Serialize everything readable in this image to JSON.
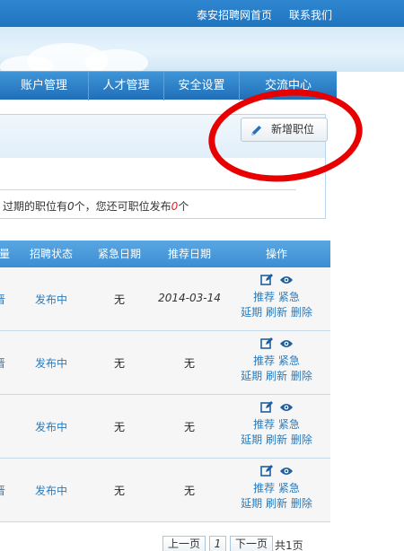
{
  "top_links": {
    "home": "泰安招聘网首页",
    "contact": "联系我们"
  },
  "nav": {
    "items": [
      "账户管理",
      "人才管理",
      "安全设置",
      "交流中心"
    ]
  },
  "toolbar": {
    "add_job_label": "新增职位"
  },
  "notice": {
    "prefix": "过期的职位有",
    "expired_count": "0",
    "middle": "个，您还可职位发布",
    "remaining_count": "0",
    "suffix": "个"
  },
  "table": {
    "headers": {
      "name": "量",
      "status": "招聘状态",
      "urgent": "紧急日期",
      "recommend": "推荐日期",
      "actions": "操作"
    },
    "rows": [
      {
        "name": "晋",
        "status": "发布中",
        "urgent": "无",
        "recommend": "2014-03-14"
      },
      {
        "name": "晋",
        "status": "发布中",
        "urgent": "无",
        "recommend": "无"
      },
      {
        "name": "",
        "status": "发布中",
        "urgent": "无",
        "recommend": "无"
      },
      {
        "name": "晋",
        "status": "发布中",
        "urgent": "无",
        "recommend": "无"
      }
    ],
    "actions": {
      "recommend": "推荐",
      "urgent": "紧急",
      "extend": "延期",
      "refresh": "刷新",
      "delete": "删除"
    }
  },
  "pager": {
    "prev": "上一页",
    "page": "1",
    "next": "下一页",
    "total": "共1页"
  },
  "colors": {
    "accent": "#1f74c0",
    "link": "#2a7bbd",
    "highlight_ring": "#e80000"
  }
}
